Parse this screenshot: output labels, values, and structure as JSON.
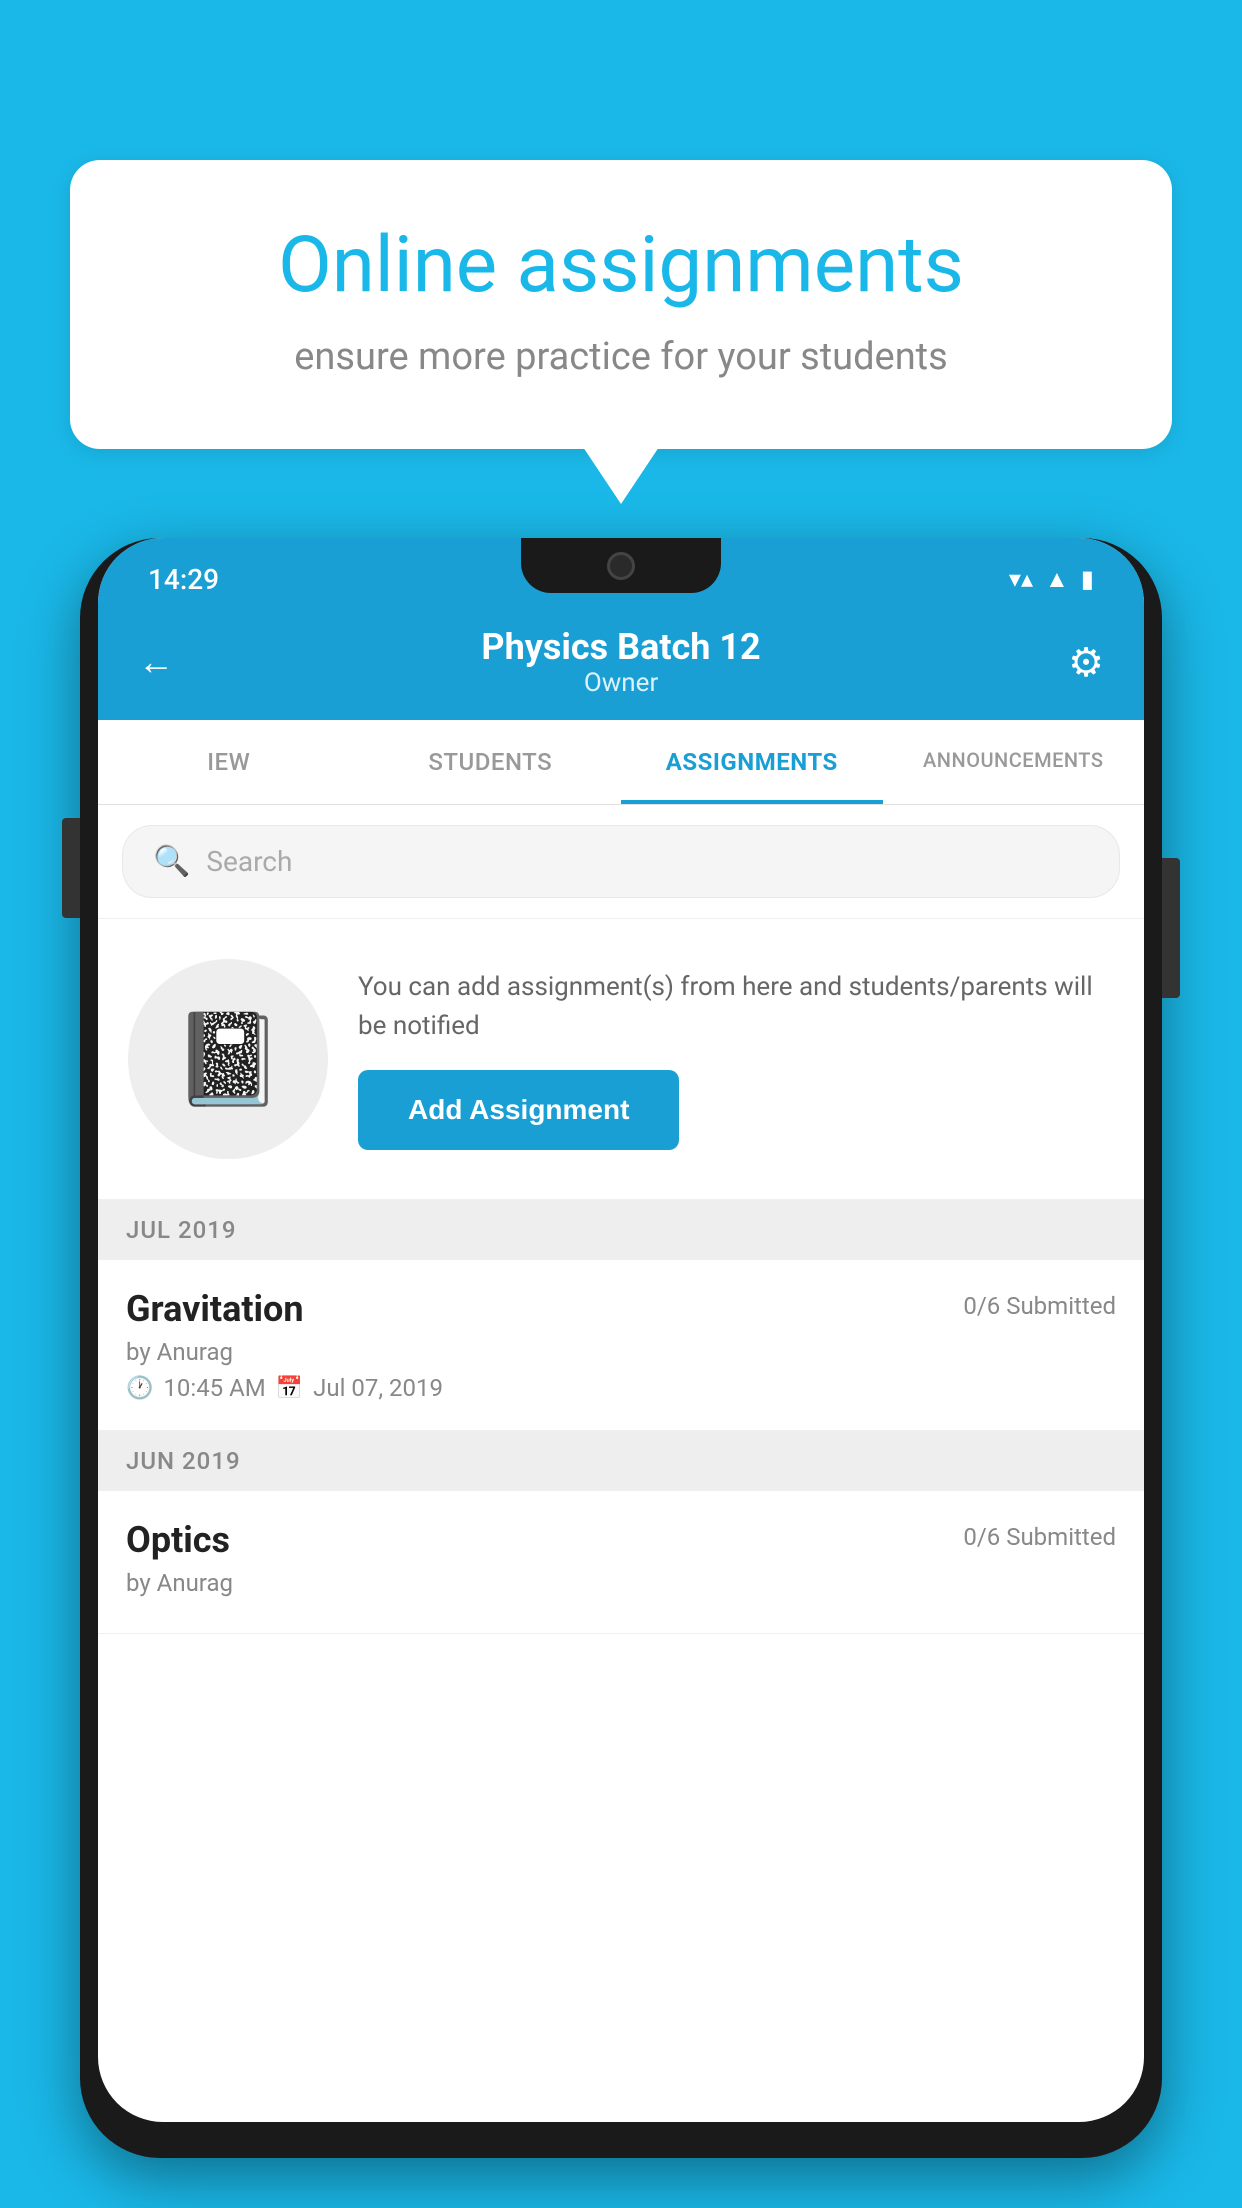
{
  "background_color": "#1ab8e8",
  "speech_bubble": {
    "title": "Online assignments",
    "subtitle": "ensure more practice for your students"
  },
  "status_bar": {
    "time": "14:29",
    "wifi_icon": "wifi",
    "signal_icon": "signal",
    "battery_icon": "battery"
  },
  "header": {
    "title": "Physics Batch 12",
    "subtitle": "Owner",
    "back_label": "←",
    "gear_label": "⚙"
  },
  "tabs": [
    {
      "label": "IEW",
      "active": false
    },
    {
      "label": "STUDENTS",
      "active": false
    },
    {
      "label": "ASSIGNMENTS",
      "active": true
    },
    {
      "label": "ANNOUNCEMENTS",
      "active": false
    }
  ],
  "search": {
    "placeholder": "Search"
  },
  "add_assignment": {
    "description": "You can add assignment(s) from here and students/parents will be notified",
    "button_label": "Add Assignment"
  },
  "sections": [
    {
      "month": "JUL 2019",
      "assignments": [
        {
          "name": "Gravitation",
          "submitted": "0/6 Submitted",
          "by": "by Anurag",
          "time": "10:45 AM",
          "date": "Jul 07, 2019"
        }
      ]
    },
    {
      "month": "JUN 2019",
      "assignments": [
        {
          "name": "Optics",
          "submitted": "0/6 Submitted",
          "by": "by Anurag",
          "time": "",
          "date": ""
        }
      ]
    }
  ]
}
